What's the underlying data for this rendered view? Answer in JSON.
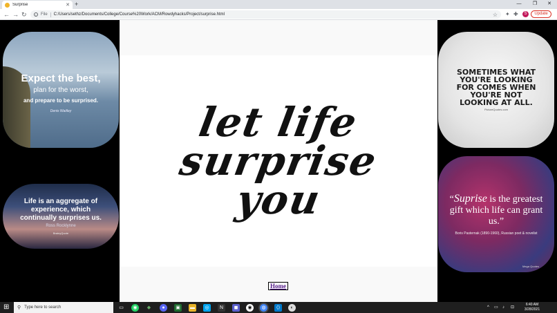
{
  "browser": {
    "tab_title": "Surprise",
    "tab_close": "✕",
    "new_tab": "+",
    "window_controls": [
      "—",
      "❐",
      "✕"
    ],
    "nav": {
      "back": "←",
      "forward": "→",
      "reload": "↻"
    },
    "url_scheme": "File",
    "url": "C:/Users/sethz/Documents/College/Course%20Work/ACM/Rowdyhacks/Project/surprise.html",
    "bookmark_icon": "☆",
    "toolbar_icons": [
      "✦",
      "✚",
      "☰"
    ],
    "avatar_letter": "S",
    "update_label": "Update",
    "menu": "⋮"
  },
  "page": {
    "hero_lines": [
      "let life",
      "surprise",
      "you"
    ],
    "home_link": "Home",
    "quotes": {
      "q1": {
        "line1": "Expect the best,",
        "line2": "plan for the worst,",
        "line3": "and prepare to be surprised.",
        "author": "Denis Waitley"
      },
      "q2": {
        "text": "Life is an aggregate of experience, which continually surprises us.",
        "author": "Ross Rocklynne",
        "credit": "BrainyQuote"
      },
      "q3": {
        "text": "SOMETIMES WHAT YOU'RE LOOKING FOR COMES WHEN YOU'RE NOT LOOKING AT ALL.",
        "credit": "PictureQuotes.com"
      },
      "q4": {
        "text_open": "“",
        "big_word": "Suprise",
        "text_rest": " is the greatest gift which life can grant us.”",
        "author": "Boris Pasternak (1890-1960), Russian poet & novelist",
        "credit": "Mega Quotes"
      }
    }
  },
  "taskbar": {
    "start_icon": "⊞",
    "search_icon": "⚲",
    "search_placeholder": "Type here to search",
    "apps": [
      "▭",
      "◉",
      "◆",
      "●",
      "▣",
      "▬",
      "◎",
      "N",
      "◼",
      "◉",
      "◍",
      "⟨⟩",
      "◐"
    ],
    "tray": [
      "^",
      "▭",
      "♪",
      "⊡"
    ],
    "time": "6:40 AM",
    "date": "3/28/2021"
  },
  "colors": {
    "frame": "#000000",
    "center_bg": "#f9f9f9",
    "hero_bg": "#ffffff",
    "link": "#551a8b",
    "update": "#d93025"
  }
}
